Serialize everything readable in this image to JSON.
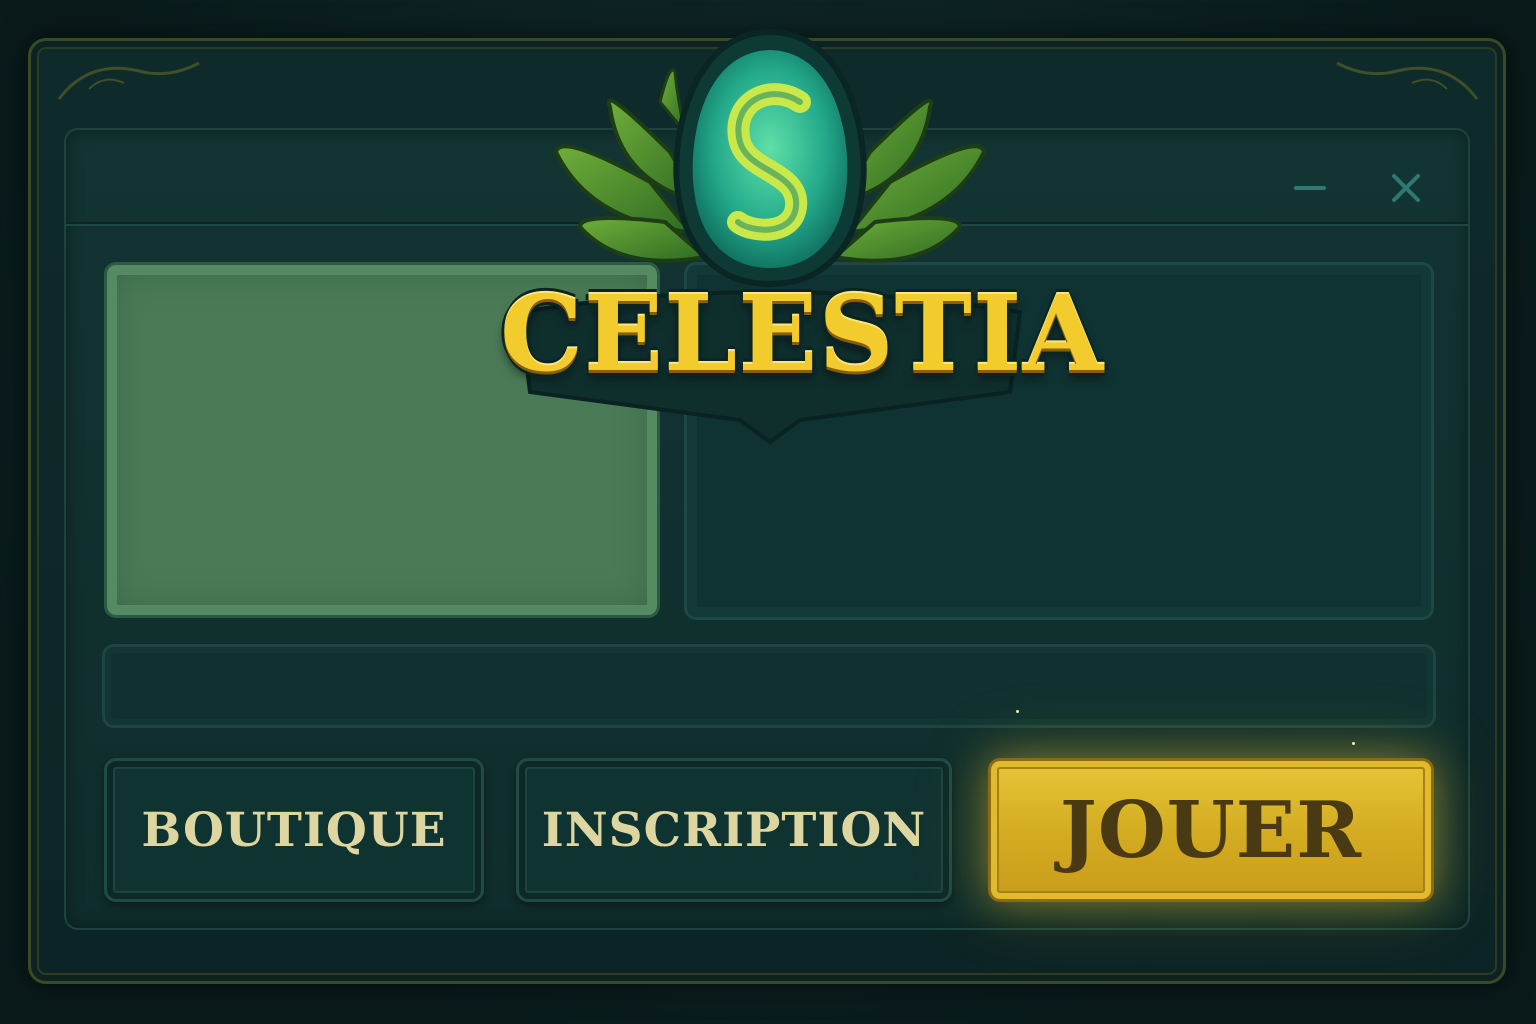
{
  "app": {
    "logo_text": "CELESTIA",
    "emblem_letter": "S"
  },
  "window_controls": {
    "minimize_icon": "minimize-icon",
    "close_icon": "close-icon"
  },
  "buttons": {
    "boutique": "BOUTIQUE",
    "inscription": "INSCRIPTION",
    "jouer": "JOUER"
  },
  "colors": {
    "accent_gold": "#e3c035",
    "panel_green": "#4a7a56",
    "background_teal": "#0f2d2c",
    "button_text": "#ddd6a0"
  }
}
